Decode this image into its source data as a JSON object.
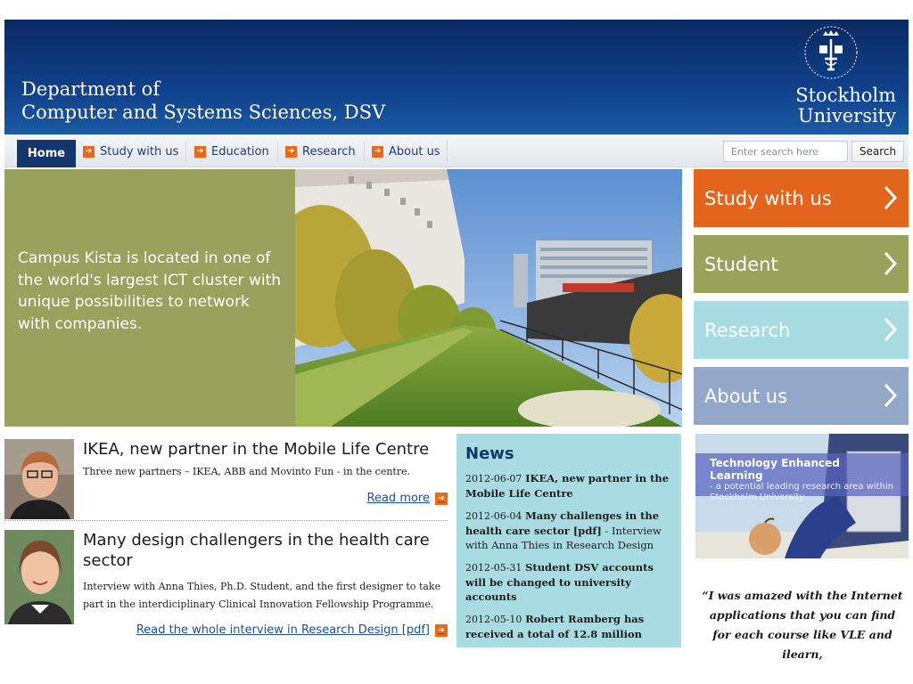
{
  "header": {
    "dept_line1": "Department of",
    "dept_line2": "Computer and Systems Sciences, DSV",
    "logo_line1": "Stockholm",
    "logo_line2": "University",
    "seal_text": "UNIVERSITET STOCKHOLMS",
    "bg_color": "#10408a"
  },
  "nav": {
    "home": "Home",
    "items": [
      "Study with us",
      "Education",
      "Research",
      "About us"
    ],
    "search_placeholder": "Enter search here",
    "search_button": "Search"
  },
  "hero": {
    "text": "Campus Kista is located in one of the world's largest ICT cluster with unique possibilities to network with companies."
  },
  "tiles": [
    "Study with us",
    "Student",
    "Research",
    "About us"
  ],
  "articles": [
    {
      "title": "IKEA, new partner in the Mobile Life Centre",
      "desc": "Three new partners – IKEA, ABB and Movinto Fun - in the centre.",
      "link": "Read more"
    },
    {
      "title": "Many design challengers in the health care sector",
      "desc": "Interview with Anna Thies, Ph.D. Student, and the first designer to take part in the interdiciplinary Clinical Innovation Fellowship Programme.",
      "link": "Read the whole interview in Research Design [pdf]"
    }
  ],
  "news": {
    "title": "News",
    "items": [
      {
        "date": "2012-06-07",
        "headline": "IKEA, new partner in the Mobile Life Centre",
        "extra": ""
      },
      {
        "date": "2012-06-04",
        "headline": "Many challenges in the health care sector [pdf]",
        "extra": " - Interview with Anna Thies in Research Design"
      },
      {
        "date": "2012-05-31",
        "headline": "Student DSV accounts will be changed to university accounts",
        "extra": ""
      },
      {
        "date": "2012-05-10",
        "headline": "Robert Ramberg has received a total of 12.8 million",
        "extra": ""
      }
    ]
  },
  "promo": {
    "head": "Technology Enhanced Learning",
    "sub": "- a potential leading research area within Stockholm University"
  },
  "quote": "“I was amazed with the Internet applications that you can find for each course like VLE and ilearn,"
}
